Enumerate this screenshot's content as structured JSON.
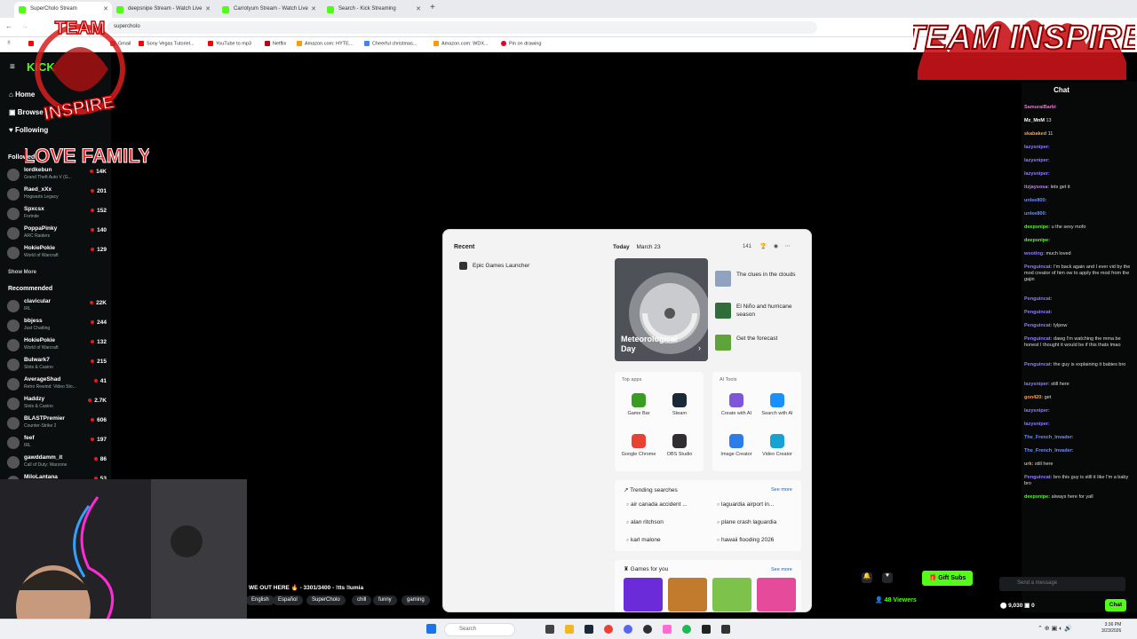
{
  "browser": {
    "tabs": [
      {
        "label": "SuperCholo Stream"
      },
      {
        "label": "deepsnipe Stream - Watch Live"
      },
      {
        "label": "Carrotyum Stream - Watch Live"
      },
      {
        "label": "Search - Kick Streaming"
      }
    ],
    "url": "superchoIo",
    "bookmarks": [
      "Gmail",
      "Sony Vegas Tutoriel...",
      "YouTube to mp3",
      "Netflix",
      "Amazon.com: HYTE...",
      "Cheerful christmas...",
      "Amazon.com: WDX...",
      "Pin on drawing"
    ]
  },
  "sidebar": {
    "nav": [
      {
        "label": "Home"
      },
      {
        "label": "Browse"
      },
      {
        "label": "Following"
      }
    ],
    "followed_label": "Followed",
    "followed": [
      {
        "name": "lordkebun",
        "game": "Grand Theft Auto V (G...",
        "viewers": "14K"
      },
      {
        "name": "Raed_xXx",
        "game": "Hogwarts Legacy",
        "viewers": "201"
      },
      {
        "name": "Spxcsx",
        "game": "Fortnite",
        "viewers": "152"
      },
      {
        "name": "PoppaPinky",
        "game": "ARC Raiders",
        "viewers": "140"
      },
      {
        "name": "HokiePokie",
        "game": "World of Warcraft",
        "viewers": "129"
      }
    ],
    "show_more": "Show More",
    "recommended_label": "Recommended",
    "recommended": [
      {
        "name": "clavicular",
        "game": "IRL",
        "viewers": "22K"
      },
      {
        "name": "bbjess",
        "game": "Just Chatting",
        "viewers": "244"
      },
      {
        "name": "HokiePokie",
        "game": "World of Warcraft",
        "viewers": "132"
      },
      {
        "name": "Bulwark7",
        "game": "Slots & Casino",
        "viewers": "215"
      },
      {
        "name": "AverageShad",
        "game": "Retro Rewind: Video Sto...",
        "viewers": "41"
      },
      {
        "name": "Haddzy",
        "game": "Slots & Casino",
        "viewers": "2.7K"
      },
      {
        "name": "BLASTPremier",
        "game": "Counter-Strike 2",
        "viewers": "606"
      },
      {
        "name": "feef",
        "game": "IRL",
        "viewers": "197"
      },
      {
        "name": "gawddamm_it",
        "game": "Call of Duty: Warzone",
        "viewers": "86"
      },
      {
        "name": "MiloLantana",
        "game": "",
        "viewers": "53"
      }
    ]
  },
  "overlay": {
    "logo_left_text": "LOVE FAMILY",
    "logo_right_text": "TEAM INSPIRE"
  },
  "chat": {
    "title": "Chat",
    "messages": [
      {
        "user": "SamuraiBarbi",
        "text": "",
        "color": "#ff6ad5"
      },
      {
        "user": "Mz_MnM",
        "text": "13",
        "color": "#fff"
      },
      {
        "user": "skabaked",
        "text": "11",
        "color": "#ff9f43"
      },
      {
        "user": "lazysniper:",
        "text": "",
        "color": "#8f7cff"
      },
      {
        "user": "lazysniper:",
        "text": "",
        "color": "#8f7cff"
      },
      {
        "user": "lazysniper:",
        "text": "",
        "color": "#8f7cff"
      },
      {
        "user": "itzjaysosa:",
        "text": "lets get it",
        "color": "#c77dff"
      },
      {
        "user": "unlee800:",
        "text": "",
        "color": "#6c8cff"
      },
      {
        "user": "unlee800:",
        "text": "",
        "color": "#6c8cff"
      },
      {
        "user": "deepsnipe:",
        "text": "u the sexy mofo",
        "color": "#53fc18"
      },
      {
        "user": "deepsnipe:",
        "text": "",
        "color": "#53fc18"
      },
      {
        "user": "wooting:",
        "text": "much loved",
        "color": "#8f7cff"
      },
      {
        "user": "Penguincat:",
        "text": "I'm back again and I ever vid by the mod creator of him ow to apply the mod from the gajin",
        "color": "#8f7cff"
      },
      {
        "user": "Penguincat:",
        "text": "",
        "color": "#8f7cff"
      },
      {
        "user": "Penguincat:",
        "text": "",
        "color": "#8f7cff"
      },
      {
        "user": "Penguincat:",
        "text": "lylpow",
        "color": "#8f7cff"
      },
      {
        "user": "Penguincat:",
        "text": "dawg I'm watching the mma be honest I thought it would be if this thats lmao",
        "color": "#8f7cff"
      },
      {
        "user": "Penguincat:",
        "text": "the guy is explaining it babies bro",
        "color": "#8f7cff"
      },
      {
        "user": "lazysniper:",
        "text": "still here",
        "color": "#8f7cff"
      },
      {
        "user": "gon420:",
        "text": "get",
        "color": "#ff9f43"
      },
      {
        "user": "lazysniper:",
        "text": "",
        "color": "#8f7cff"
      },
      {
        "user": "lazysniper:",
        "text": "",
        "color": "#8f7cff"
      },
      {
        "user": "The_French_Invader:",
        "text": "",
        "color": "#6c8cff"
      },
      {
        "user": "The_French_Invader:",
        "text": "",
        "color": "#6c8cff"
      },
      {
        "user": "urk:",
        "text": "still here",
        "color": "#ff9f43"
      },
      {
        "user": "Penguincat:",
        "text": "bro this guy is still it like I'm a baby bro",
        "color": "#8f7cff"
      },
      {
        "user": "deepsnipe:",
        "text": "always here for yall",
        "color": "#53fc18"
      }
    ],
    "input_placeholder": "Send a message",
    "points": "9,030",
    "count": "0",
    "send_label": "Chat"
  },
  "stream": {
    "title": "WE OUT HERE 🔥 - 3301/3400 - !tts !lumia",
    "tags": [
      "English",
      "Español",
      "SuperCholo",
      "chill",
      "funny",
      "gaming"
    ],
    "viewers": "48 Viewers",
    "gift_label": "Gift Subs"
  },
  "start_menu": {
    "recent_label": "Recent",
    "recent_items": [
      "Epic Games Launcher"
    ],
    "today_label": "Today",
    "date": "March 23",
    "points": "141",
    "hero_title": "Meteorological Day",
    "news": [
      "The clues in the clouds",
      "El Niño and hurricane season",
      "Get the forecast"
    ],
    "top_apps_label": "Top apps",
    "top_apps": [
      {
        "label": "Game Bar",
        "color": "#3a9d23"
      },
      {
        "label": "Steam",
        "color": "#1b2838"
      },
      {
        "label": "Google Chrome",
        "color": "#e94235"
      },
      {
        "label": "OBS Studio",
        "color": "#302e31"
      }
    ],
    "ai_tools_label": "AI Tools",
    "ai_tools": [
      {
        "label": "Create with AI",
        "color": "#7f56d9"
      },
      {
        "label": "Search with AI",
        "color": "#1a90ff"
      },
      {
        "label": "Image Creator",
        "color": "#2b7de9"
      },
      {
        "label": "Video Creator",
        "color": "#17a2d4"
      }
    ],
    "trending_label": "Trending searches",
    "see_more": "See more",
    "trending": [
      "air canada accident ...",
      "laguardia airport in...",
      "alan ritchson",
      "plane crash laguardia",
      "karl malone",
      "hawaii flooding 2026"
    ],
    "games_label": "Games for you"
  },
  "taskbar": {
    "search_placeholder": "Search",
    "time": "3:36 PM",
    "date": "3/23/2026"
  }
}
